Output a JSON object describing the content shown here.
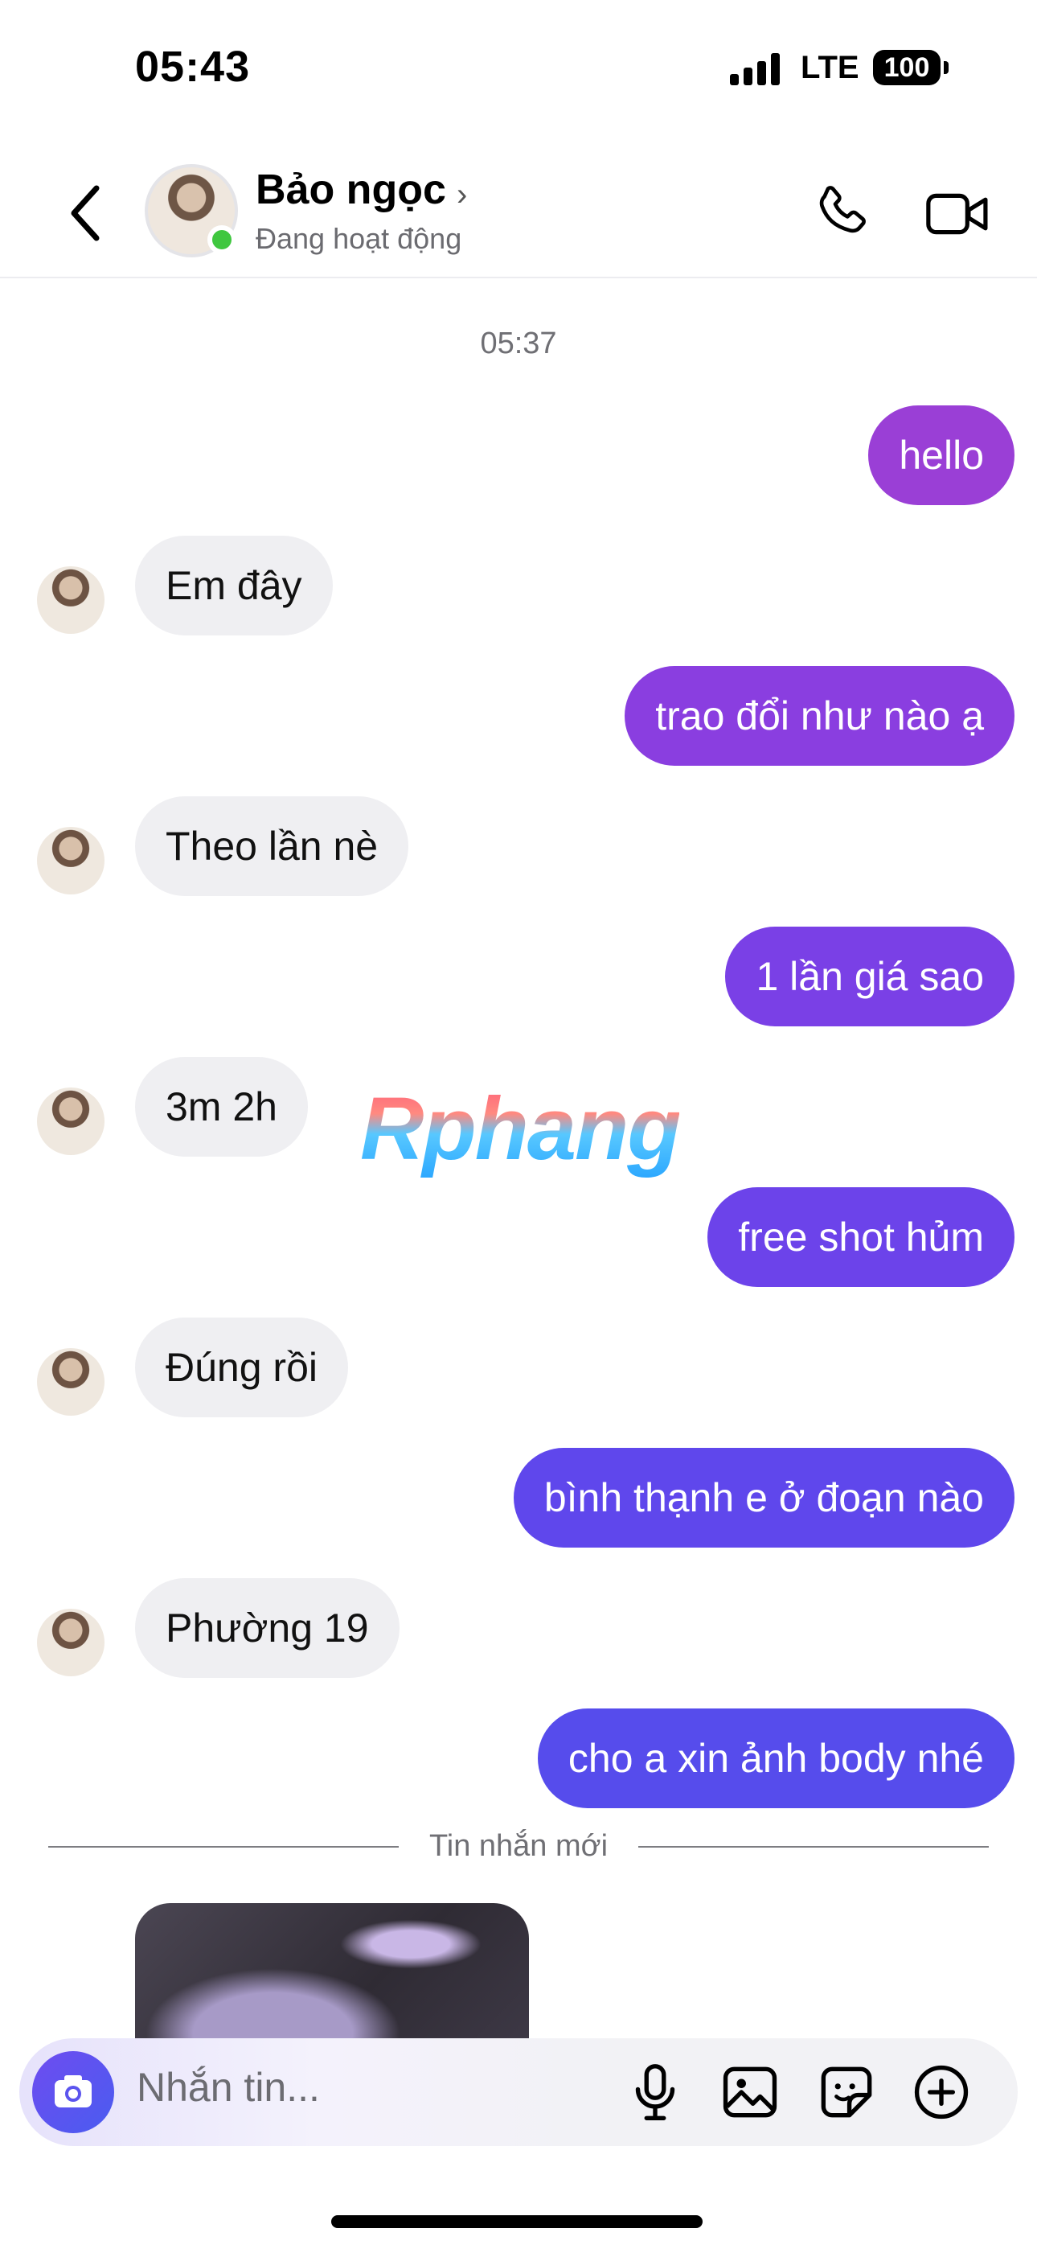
{
  "status_bar": {
    "time": "05:43",
    "network": "LTE",
    "battery": "100"
  },
  "header": {
    "name": "Bảo ngọc",
    "status": "Đang hoạt động"
  },
  "timestamp": "05:37",
  "messages": [
    {
      "text": "hello",
      "from": "me",
      "color": "#9a3fd6"
    },
    {
      "text": "Em đây",
      "from": "them"
    },
    {
      "text": "trao đổi như nào ạ",
      "from": "me",
      "color": "#8a3ee0"
    },
    {
      "text": "Theo lần nè",
      "from": "them"
    },
    {
      "text": "1 lần giá sao",
      "from": "me",
      "color": "#7a40e6"
    },
    {
      "text": "3m 2h",
      "from": "them"
    },
    {
      "text": "free shot hủm",
      "from": "me",
      "color": "#6c43ea"
    },
    {
      "text": "Đúng rồi",
      "from": "them"
    },
    {
      "text": "bình thạnh e ở đoạn nào",
      "from": "me",
      "color": "#5f47ec"
    },
    {
      "text": "Phường 19",
      "from": "them"
    },
    {
      "text": "cho a xin ảnh body nhé",
      "from": "me",
      "color": "#564cec"
    }
  ],
  "watermark": "Rphang",
  "new_messages_label": "Tin nhắn mới",
  "composer": {
    "placeholder": "Nhắn tin..."
  },
  "icons": [
    "back-chevron-icon",
    "phone-icon",
    "video-camera-icon",
    "camera-icon",
    "microphone-icon",
    "gallery-icon",
    "sticker-icon",
    "plus-circle-icon"
  ]
}
